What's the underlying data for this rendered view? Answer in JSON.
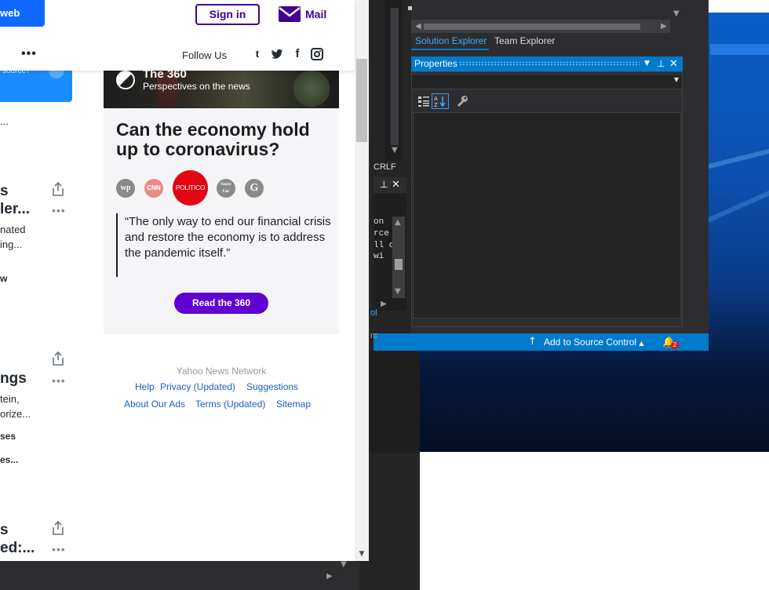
{
  "browser": {
    "header": {
      "web_button_label": "web",
      "sign_in_label": "Sign in",
      "mail_label": "Mail",
      "more_label": "•••",
      "follow_us_label": "Follow Us",
      "social_icons": [
        "tumblr-icon",
        "twitter-icon",
        "facebook-icon",
        "instagram-icon"
      ]
    },
    "source_chip": {
      "text": "source?"
    },
    "stream": [
      {
        "line1": "..."
      },
      {
        "heading1": "s",
        "heading2": "ler...",
        "snippet1": "nated",
        "snippet2": "ing...",
        "byline": "w"
      },
      {
        "heading1": "ngs",
        "snippet1": "tein,",
        "snippet2": "orize...",
        "byline1": "ses",
        "byline2": "es..."
      },
      {
        "heading1": "s",
        "heading2": "ed:..."
      }
    ],
    "card_360": {
      "brand": "The 360",
      "tagline": "Perspectives on the news",
      "title": "Can the economy hold up to coronavirus?",
      "publishers": [
        "wp",
        "CNN",
        "POLITICO",
        "Vanity Fair",
        "G"
      ],
      "quote": "“The only way to end our financial crisis and restore the economy is to address the pandemic itself.”",
      "cta": "Read the 360"
    },
    "footer": {
      "network": "Yahoo News Network",
      "links_row1": [
        "Help",
        "Privacy (Updated)",
        "Suggestions"
      ],
      "links_row2": [
        "About Our Ads",
        "Terms (Updated)",
        "Sitemap"
      ]
    }
  },
  "visual_studio": {
    "tabs": [
      "Solution Explorer",
      "Team Explorer"
    ],
    "properties_title": "Properties",
    "line_ending": "CRLF",
    "code_fragments": [
      "on",
      "rce",
      "ll c",
      " wi"
    ],
    "left_fragments": [
      "ol",
      "rc"
    ],
    "status": {
      "source_control": "Add to Source Control",
      "notifications": "2"
    }
  },
  "colors": {
    "yahoo_purple": "#6001d2",
    "yahoo_blue": "#0f69ff",
    "vs_blue": "#007acc",
    "politico_red": "#e20613"
  }
}
